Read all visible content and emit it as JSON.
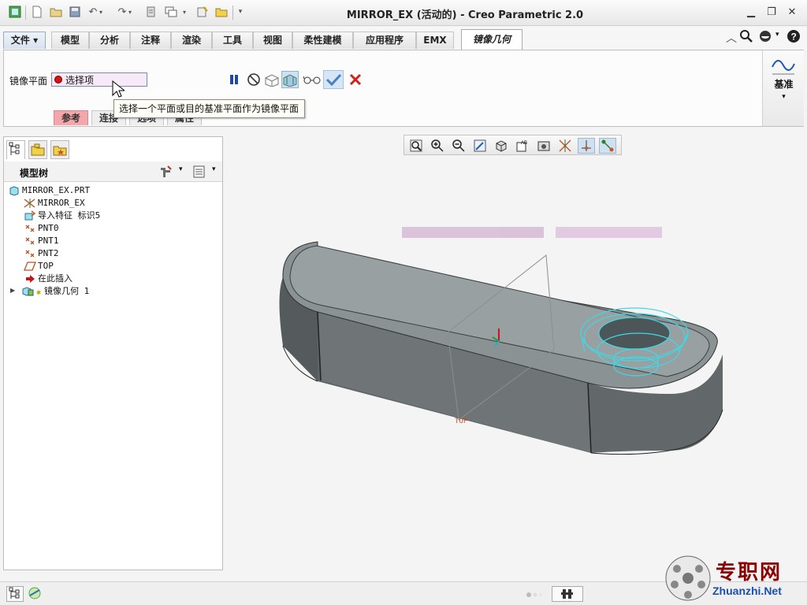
{
  "window": {
    "title": "MIRROR_EX (活动的) - Creo Parametric 2.0"
  },
  "menu_tabs": [
    {
      "label": "文件 ▾"
    },
    {
      "label": "模型"
    },
    {
      "label": "分析"
    },
    {
      "label": "注释"
    },
    {
      "label": "渲染"
    },
    {
      "label": "工具"
    },
    {
      "label": "视图"
    },
    {
      "label": "柔性建模"
    },
    {
      "label": "应用程序"
    },
    {
      "label": "EMX"
    },
    {
      "label": "镜像几何"
    }
  ],
  "dashboard": {
    "mirror_plane_label": "镜像平面",
    "collector_value": "选择项",
    "tooltip": "选择一个平面或目的基准平面作为镜像平面",
    "subtabs": [
      "参考",
      "连接",
      "选项",
      "属性"
    ],
    "datum_label": "基准"
  },
  "model_tree": {
    "header": "模型树",
    "items": [
      {
        "label": "MIRROR_EX.PRT",
        "icon": "part-icon"
      },
      {
        "label": "MIRROR_EX",
        "icon": "csys-icon"
      },
      {
        "label": "导入特征 标识5",
        "icon": "import-feature-icon"
      },
      {
        "label": "PNT0",
        "icon": "datum-point-icon"
      },
      {
        "label": "PNT1",
        "icon": "datum-point-icon"
      },
      {
        "label": "PNT2",
        "icon": "datum-point-icon"
      },
      {
        "label": "TOP",
        "icon": "datum-plane-icon"
      },
      {
        "label": "在此插入",
        "icon": "insert-here-arrow-icon"
      },
      {
        "label": "镜像几何 1",
        "icon": "mirror-geometry-icon"
      }
    ]
  },
  "graphics": {
    "datum_plane_label": "TOP"
  },
  "watermark": {
    "text_cn": "专职网",
    "text_en": "Zhuanzhi.Net"
  },
  "colors": {
    "accent_cyan": "#3fd8e6",
    "cancel_red": "#d0201a",
    "ok_blue": "#4a7fc0",
    "subtab_active": "#f3a7aa"
  }
}
